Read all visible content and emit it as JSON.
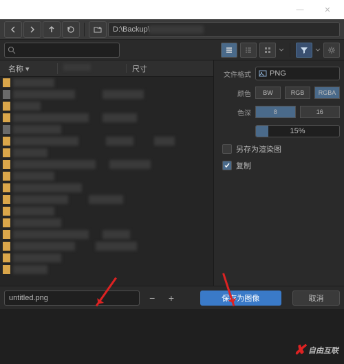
{
  "titlebar": {
    "minimize": "—",
    "close": "✕"
  },
  "toolbar": {
    "path": "D:\\Backup\\"
  },
  "search": {
    "placeholder": ""
  },
  "columns": {
    "name": "名称",
    "modified": "修改日期",
    "size": "尺寸"
  },
  "sidepanel": {
    "format_label": "文件格式",
    "format_value": "PNG",
    "color_label": "颜色",
    "color_opts": [
      "BW",
      "RGB",
      "RGBA"
    ],
    "depth_label": "色深",
    "depth_opts": [
      "8",
      "16"
    ],
    "compression": "15%",
    "render_label": "另存为渲染图",
    "copy_label": "复制"
  },
  "bottom": {
    "filename": "untitled.png",
    "save": "保存为图像",
    "cancel": "取消"
  },
  "watermark": {
    "text": "自由互联"
  }
}
